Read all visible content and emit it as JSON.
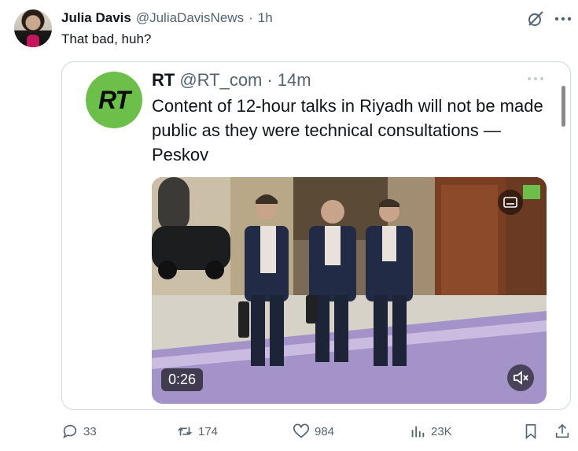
{
  "tweet": {
    "author_name": "Julia Davis",
    "handle": "@JuliaDavisNews",
    "separator": "·",
    "time": "1h",
    "text": "That bad, huh?"
  },
  "quoted": {
    "logo_text": "RT",
    "author_name": "RT",
    "handle": "@RT_com",
    "separator": "·",
    "time": "14m",
    "text": "Content of 12-hour talks in Riyadh will not be made public as they were technical consultations — Peskov",
    "video": {
      "duration": "0:26"
    }
  },
  "actions": {
    "replies": "33",
    "reposts": "174",
    "likes": "984",
    "views": "23K"
  },
  "icons": {
    "grok": "grok-icon",
    "more": "more-icon",
    "reply": "reply-icon",
    "repost": "repost-icon",
    "like": "like-icon",
    "views": "views-icon",
    "bookmark": "bookmark-icon",
    "share": "share-icon",
    "mute": "mute-icon",
    "captions": "captions-icon"
  },
  "colors": {
    "rt_green": "#6cc04a",
    "muted_text": "#536471",
    "border": "#cfd9de"
  }
}
